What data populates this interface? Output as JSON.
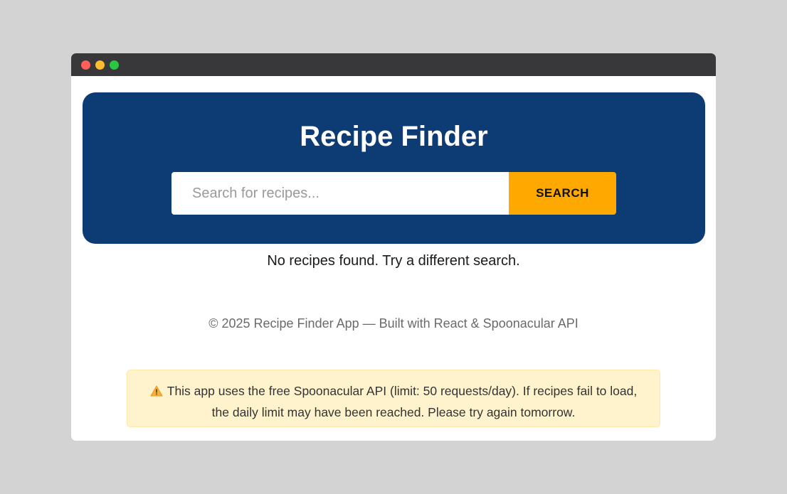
{
  "window": {
    "controls": [
      "close",
      "minimize",
      "maximize"
    ]
  },
  "header": {
    "title": "Recipe Finder"
  },
  "search": {
    "placeholder": "Search for recipes...",
    "value": "",
    "button_label": "SEARCH"
  },
  "results": {
    "empty_message": "No recipes found. Try a different search."
  },
  "footer": {
    "text": "© 2025 Recipe Finder App — Built with React & Spoonacular API"
  },
  "notice": {
    "icon": "warning-icon",
    "line1": "This app uses the free Spoonacular API (limit: 50 requests/day). If recipes fail to load,",
    "line2": "the daily limit may have been reached. Please try again tomorrow."
  },
  "colors": {
    "hero_background": "#0d3b73",
    "accent": "#ffa800",
    "notice_background": "#fff3cd"
  }
}
